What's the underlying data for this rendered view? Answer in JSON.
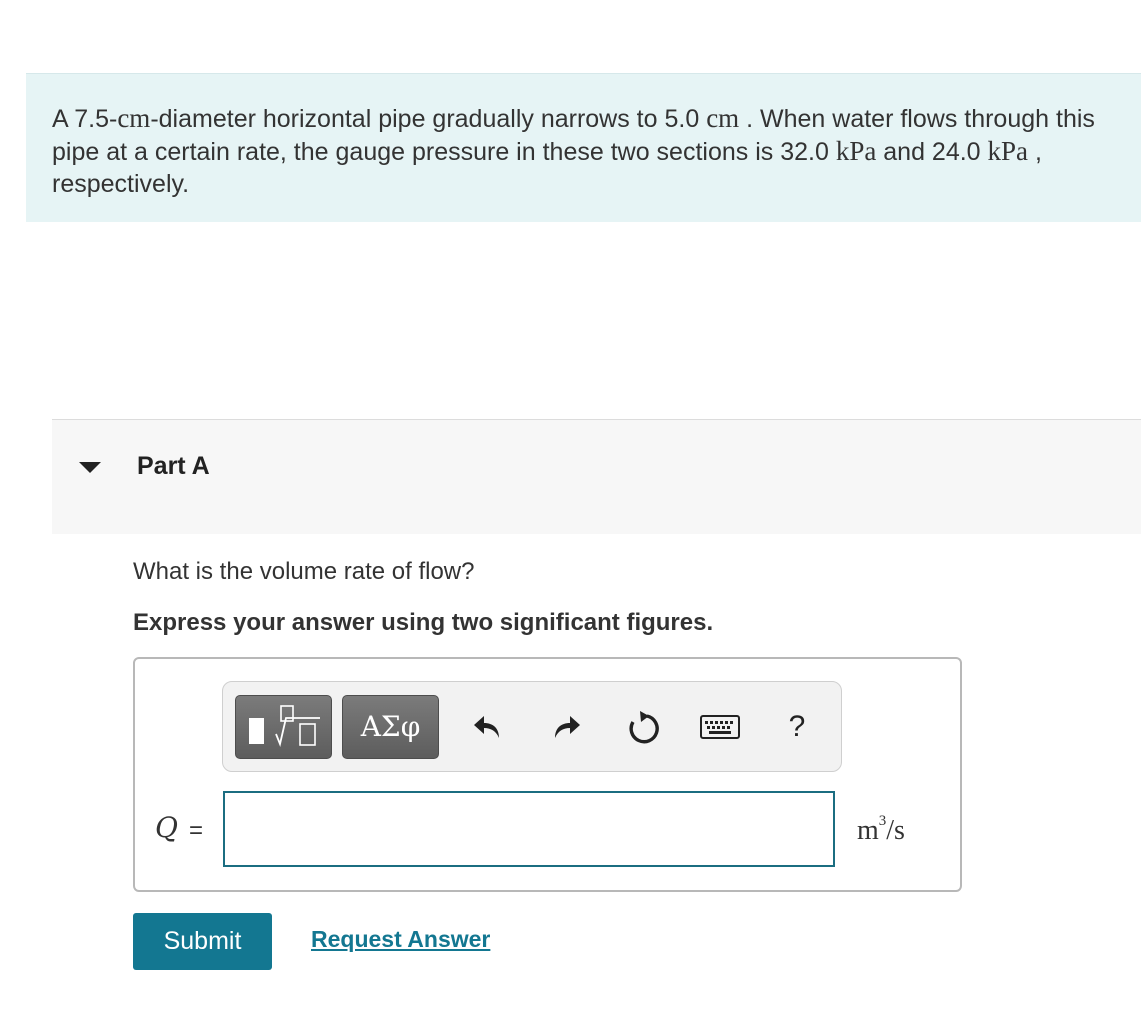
{
  "problem": {
    "part1": "A 7.5-",
    "unit_cm": "cm",
    "part2": "-diameter horizontal pipe gradually narrows to 5.0 ",
    "unit_cm2": "cm",
    "part3": " . When water flows through this pipe at a certain rate, the gauge pressure in these two sections is 32.0 ",
    "unit_kpa": "kPa",
    "part4": " and 24.0 ",
    "unit_kpa2": "kPa",
    "part5": " , respectively."
  },
  "part": {
    "title": "Part A",
    "question": "What is the volume rate of flow?",
    "instruction": "Express your answer using two significant figures."
  },
  "toolbar": {
    "greek_label": "ΑΣφ",
    "help_label": "?"
  },
  "answer": {
    "variable": "Q",
    "equals": "=",
    "value": "",
    "unit_base": "m",
    "unit_exp": "3",
    "unit_rest": "/s"
  },
  "actions": {
    "submit_label": "Submit",
    "request_label": "Request Answer"
  },
  "colors": {
    "problem_bg": "#e6f4f5",
    "accent": "#137791",
    "input_border": "#1b6d81"
  },
  "icons": [
    "caret-down-icon",
    "templates-icon",
    "undo-icon",
    "redo-icon",
    "reset-icon",
    "keyboard-icon",
    "help-icon"
  ]
}
